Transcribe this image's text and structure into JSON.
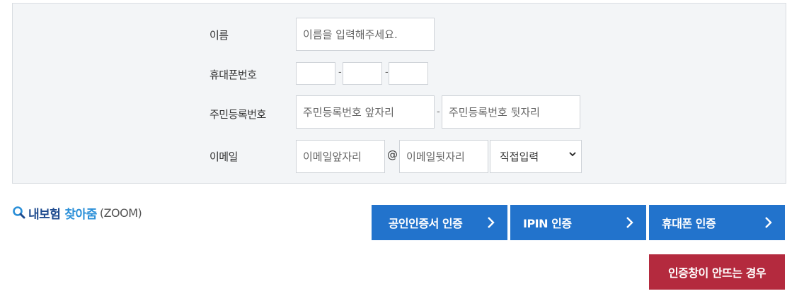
{
  "form": {
    "name": {
      "label": "이름",
      "placeholder": "이름을 입력해주세요."
    },
    "phone": {
      "label": "휴대폰번호",
      "separator": "-"
    },
    "rrn": {
      "label": "주민등록번호",
      "front_placeholder": "주민등록번호 앞자리",
      "back_placeholder": "주민등록번호 뒷자리",
      "separator": "-"
    },
    "email": {
      "label": "이메일",
      "local_placeholder": "이메일앞자리",
      "at": "@",
      "domain_placeholder": "이메일뒷자리",
      "domain_select": "직접입력"
    }
  },
  "logo": {
    "word1": "내보험",
    "word2": "찾아줌",
    "word3": "(ZOOM)",
    "icon": "magnifier-icon"
  },
  "buttons": {
    "cert": "공인인증서 인증",
    "ipin": "IPIN 인증",
    "phone": "휴대폰 인증",
    "popup_help": "인증창이 안뜨는 경우"
  },
  "colors": {
    "panel_bg": "#f3f5f7",
    "button_blue": "#2273cc",
    "button_red": "#b42a3e"
  }
}
